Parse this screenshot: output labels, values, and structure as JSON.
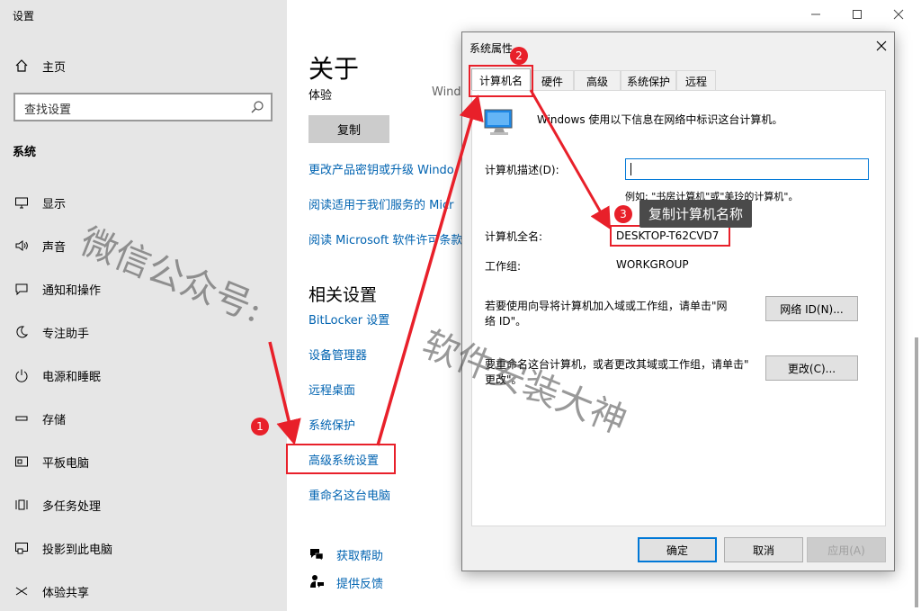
{
  "app": {
    "title": "设置"
  },
  "sidebar": {
    "home": "主页",
    "search_placeholder": "查找设置",
    "section": "系统",
    "items": [
      {
        "label": "显示",
        "icon": "monitor-icon"
      },
      {
        "label": "声音",
        "icon": "speaker-icon"
      },
      {
        "label": "通知和操作",
        "icon": "notification-icon"
      },
      {
        "label": "专注助手",
        "icon": "moon-icon"
      },
      {
        "label": "电源和睡眠",
        "icon": "power-icon"
      },
      {
        "label": "存储",
        "icon": "storage-icon"
      },
      {
        "label": "平板电脑",
        "icon": "tablet-icon"
      },
      {
        "label": "多任务处理",
        "icon": "multitask-icon"
      },
      {
        "label": "投影到此电脑",
        "icon": "project-icon"
      },
      {
        "label": "体验共享",
        "icon": "share-icon"
      }
    ]
  },
  "about": {
    "title": "关于",
    "subtitle": "体验",
    "subtitle_value": "Windo",
    "copy_button": "复制",
    "links": [
      "更改产品密钥或升级 Windo",
      "阅读适用于我们服务的 Micr",
      "阅读 Microsoft 软件许可条款"
    ],
    "related_title": "相关设置",
    "related_links": [
      "BitLocker 设置",
      "设备管理器",
      "远程桌面",
      "系统保护",
      "高级系统设置",
      "重命名这台电脑"
    ],
    "help_links": [
      "获取帮助",
      "提供反馈"
    ]
  },
  "dialog": {
    "title": "系统属性",
    "tabs": [
      "计算机名",
      "硬件",
      "高级",
      "系统保护",
      "远程"
    ],
    "intro": "Windows 使用以下信息在网络中标识这台计算机。",
    "desc_label": "计算机描述(D):",
    "desc_example": "例如: \"书房计算机\"或\"美玲的计算机\"。",
    "fullname_label": "计算机全名:",
    "fullname_value": "DESKTOP-T62CVD7",
    "workgroup_label": "工作组:",
    "workgroup_value": "WORKGROUP",
    "join_text_1": "若要使用向导将计算机加入域或工作组，请单击\"网",
    "join_text_2": "络 ID\"。",
    "network_id_button": "网络 ID(N)...",
    "rename_text_1": "要重命名这台计算机，或者更改其域或工作组，请单击\"",
    "rename_text_2": "更改\"。",
    "change_button": "更改(C)...",
    "ok_button": "确定",
    "cancel_button": "取消",
    "apply_button": "应用(A)"
  },
  "annotations": {
    "badge_1": "1",
    "badge_2": "2",
    "badge_3": "3",
    "tip": "复制计算机名称",
    "color": "#e8202a"
  },
  "watermark": {
    "line_1": "微信公众号:",
    "line_2": "软件安装大神"
  }
}
